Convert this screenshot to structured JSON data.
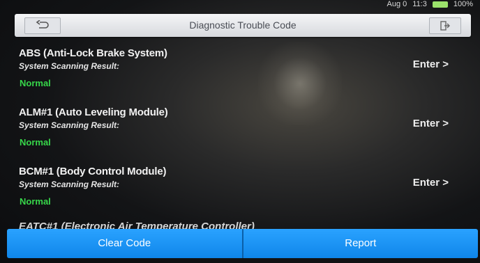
{
  "status_bar": {
    "date": "Aug 0",
    "time": "11:3",
    "battery": "100%"
  },
  "header": {
    "title": "Diagnostic Trouble Code",
    "back_icon": "back-arrow-icon",
    "exit_icon": "exit-icon"
  },
  "items": [
    {
      "title": "ABS (Anti-Lock Brake System)",
      "subtitle": "System Scanning Result:",
      "status": "Normal",
      "action": "Enter >"
    },
    {
      "title": "ALM#1 (Auto Leveling Module)",
      "subtitle": "System Scanning Result:",
      "status": "Normal",
      "action": "Enter >"
    },
    {
      "title": "BCM#1 (Body Control Module)",
      "subtitle": "System Scanning Result:",
      "status": "Normal",
      "action": "Enter >"
    }
  ],
  "partial_item": {
    "title": "EATC#1 (Electronic Air Temperature Controller)"
  },
  "buttons": {
    "clear_code": "Clear Code",
    "report": "Report"
  },
  "colors": {
    "normal_status": "#37d64a",
    "button_blue": "#1b95f5",
    "header_bg": "#e6e7ea"
  }
}
